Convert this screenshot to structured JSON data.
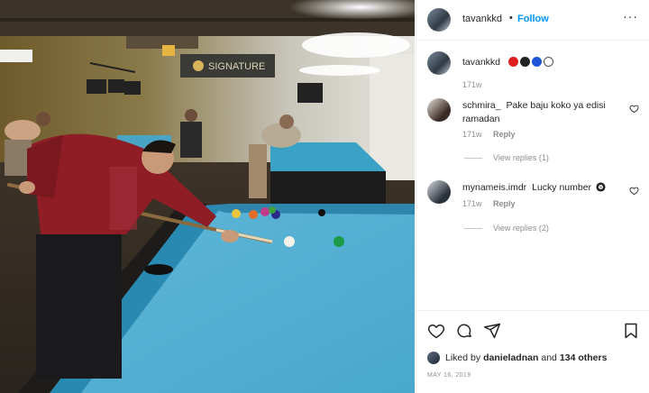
{
  "post": {
    "author": "tavankkd",
    "follow_label": "Follow",
    "dot": "•",
    "more": "···",
    "caption_time": "171w",
    "caption_circle_colors": [
      "#e02020",
      "#222222",
      "#1f55d8",
      "#ffffff"
    ]
  },
  "photo": {
    "sign_text": "SIGNATURE"
  },
  "comments": [
    {
      "user": "schmira_",
      "text": "Pake baju koko ya edisi ramadan",
      "time": "171w",
      "reply_label": "Reply",
      "view_replies": "View replies (1)"
    },
    {
      "user": "mynameis.imdr",
      "text": "Lucky number",
      "time": "171w",
      "reply_label": "Reply",
      "view_replies": "View replies (2)"
    }
  ],
  "likes": {
    "prefix": "Liked by",
    "user": "danieladnan",
    "joiner": "and",
    "others": "134 others"
  },
  "date": "MAY 16, 2019",
  "icons": {
    "like": "heart-icon",
    "comment": "comment-icon",
    "share": "share-icon",
    "save": "bookmark-icon",
    "more": "more-icon",
    "comment_like": "heart-icon",
    "eight_ball": "eight-ball-icon"
  }
}
